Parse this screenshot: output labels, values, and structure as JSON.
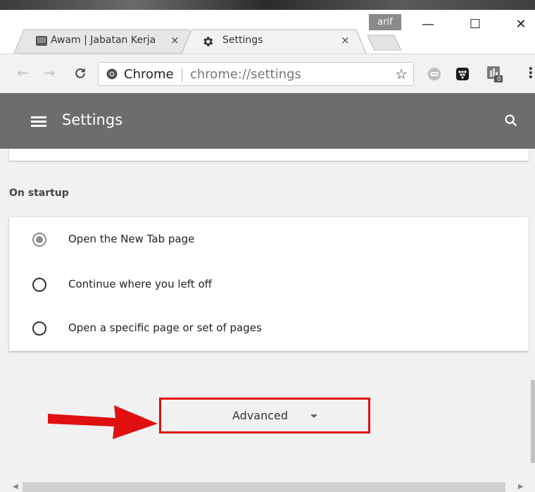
{
  "window": {
    "profile_name": "arif",
    "minimize_glyph": "—",
    "maximize_glyph": "☐",
    "close_glyph": "✕"
  },
  "tabs": [
    {
      "title": "Awam | Jabatan Kerja",
      "icon": "page-favicon-icon",
      "close": "×",
      "active": false
    },
    {
      "title": "Settings",
      "icon": "gear-icon",
      "close": "×",
      "active": true
    }
  ],
  "toolbar": {
    "back_glyph": "←",
    "forward_glyph": "→",
    "reload_glyph": "C",
    "site_label": "Chrome",
    "url": "chrome://settings",
    "star_glyph": "☆",
    "menu_glyph": "⋮",
    "extensions": [
      "chat-extension-icon",
      "blackberry-extension-icon",
      "badge-extension-icon"
    ],
    "extension_badge": "0"
  },
  "header": {
    "title": "Settings",
    "bg_color": "#6d6d6d"
  },
  "on_startup": {
    "section_title": "On startup",
    "options": [
      {
        "label": "Open the New Tab page",
        "checked": true
      },
      {
        "label": "Continue where you left off",
        "checked": false
      },
      {
        "label": "Open a specific page or set of pages",
        "checked": false
      }
    ]
  },
  "advanced": {
    "label": "Advanced",
    "highlight_color": "#e01010"
  },
  "scrollbar": {
    "left_arrow": "◀",
    "right_arrow": "▶"
  }
}
